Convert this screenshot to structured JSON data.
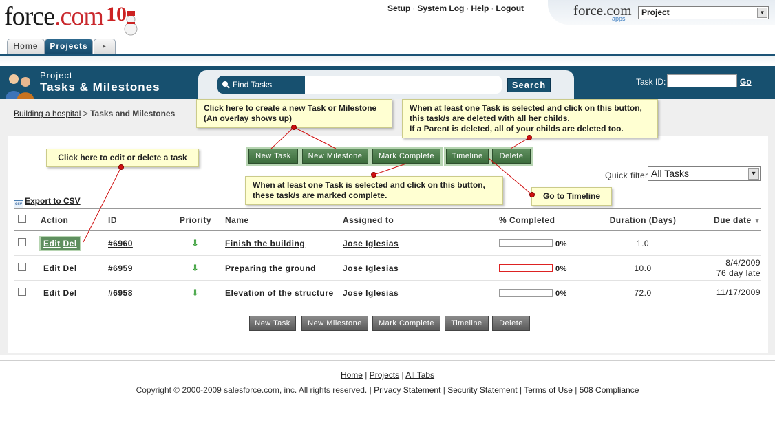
{
  "header": {
    "logo_text": "force",
    "logo_dot": ".com",
    "logo_ten": "10",
    "links": [
      "Setup",
      "System Log",
      "Help",
      "Logout"
    ],
    "separator": "·",
    "brand_right": "force.com",
    "brand_apps": "apps",
    "app_selector_value": "Project"
  },
  "tabs": {
    "home": "Home",
    "projects": "Projects",
    "more": "▸"
  },
  "page": {
    "subtitle": "Project",
    "title": "Tasks & Milestones"
  },
  "search": {
    "label": "Find Tasks",
    "value": "",
    "button": "Search",
    "task_id_label": "Task ID:",
    "task_id_value": "",
    "go": "Go"
  },
  "breadcrumb": {
    "parent": "Building a hospital",
    "separator": ">",
    "current": "Tasks and Milestones"
  },
  "toolbar": {
    "new_task": "New Task",
    "new_milestone": "New Milestone",
    "mark_complete": "Mark Complete",
    "timeline": "Timeline",
    "delete": "Delete"
  },
  "quickfilter": {
    "label": "Quick filter:",
    "value": "All Tasks"
  },
  "export": {
    "icon_text": "csv",
    "label": "Export to CSV"
  },
  "table": {
    "headers": {
      "action": "Action",
      "id": "ID",
      "priority": "Priority",
      "name": "Name",
      "assigned": "Assigned to",
      "completed": "% Completed",
      "duration": "Duration (Days)",
      "due": "Due date"
    },
    "edit": "Edit",
    "del": "Del",
    "priority_glyph": "⇩",
    "rows": [
      {
        "id": "#6960",
        "name": "Finish the building",
        "assigned": "Jose Iglesias",
        "progress": 0,
        "pct": "0%",
        "duration": "1.0",
        "due": "",
        "due_note": "",
        "late": false
      },
      {
        "id": "#6959",
        "name": "Preparing the ground",
        "assigned": "Jose Iglesias",
        "progress": 0,
        "pct": "0%",
        "duration": "10.0",
        "due": "8/4/2009",
        "due_note": "76 day late",
        "late": true
      },
      {
        "id": "#6958",
        "name": "Elevation of the structure",
        "assigned": "Jose Iglesias",
        "progress": 0,
        "pct": "0%",
        "duration": "72.0",
        "due": "11/17/2009",
        "due_note": "",
        "late": false
      }
    ]
  },
  "callouts": {
    "new_task_line1": "Click here to create a new Task or Milestone",
    "new_task_line2": "(An overlay shows up)",
    "delete_line1": "When at least one Task is selected and click on this button,",
    "delete_line2": "this task/s are deleted with all her childs.",
    "delete_line3": "If a Parent is deleted, all of your childs are deleted too.",
    "edit": "Click here to edit or delete a task",
    "complete_line1": "When at least one Task is selected and click on this button,",
    "complete_line2": "these task/s are marked complete.",
    "timeline": "Go to Timeline"
  },
  "footer": {
    "links": [
      "Home",
      "Projects",
      "All Tabs"
    ],
    "copyright": "Copyright © 2000-2009 salesforce.com, inc. All rights reserved.",
    "legal": [
      "Privacy Statement",
      "Security Statement",
      "Terms of Use",
      "508 Compliance"
    ]
  },
  "colors": {
    "brand_blue": "#17506f",
    "button_green": "#3b6c3b",
    "button_gray": "#5a5a5a",
    "callout_bg": "#ffffd2",
    "pin_red": "#d01010"
  }
}
